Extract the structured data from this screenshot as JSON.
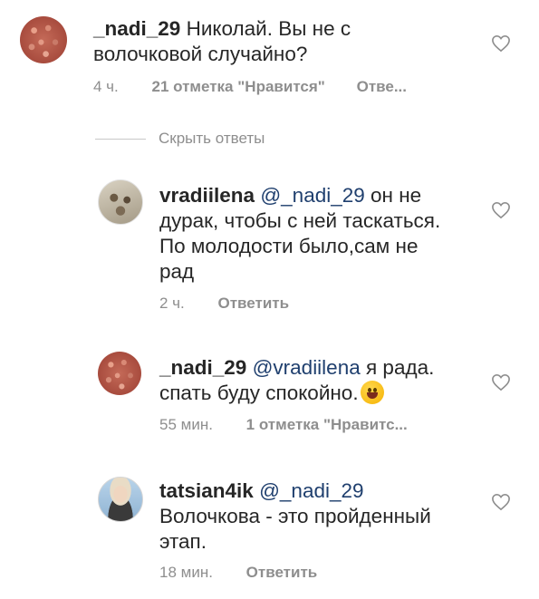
{
  "comments": [
    {
      "username": "_nadi_29",
      "text": "Николай. Вы не с волочковой случайно?",
      "line1": "Николай. Вы не с",
      "line2": "волочковой случайно?",
      "time": "4 ч.",
      "likes": "21 отметка \"Нравится\"",
      "reply": "Отве..."
    },
    {
      "username": "vradiilena",
      "mention": "@_nadi_29",
      "line1": "он не",
      "line2": "дурак, чтобы с ней таскаться.",
      "line3": "По молодости было,сам не",
      "line4": "рад",
      "time": "2 ч.",
      "reply": "Ответить"
    },
    {
      "username": "_nadi_29",
      "mention": "@vradiilena",
      "line1": "я рада.",
      "line2": "спать буду спокойно.",
      "time": "55 мин.",
      "likes": "1 отметка \"Нравитс..."
    },
    {
      "username": "tatsian4ik",
      "mention": "@_nadi_29",
      "line2": "Волочкова - это пройденный",
      "line3": "этап.",
      "time": "18 мин.",
      "reply": "Ответить"
    }
  ],
  "hide_replies": "Скрыть ответы",
  "icons": {
    "like": "heart-icon",
    "emoji": "smiling-face-emoji"
  }
}
